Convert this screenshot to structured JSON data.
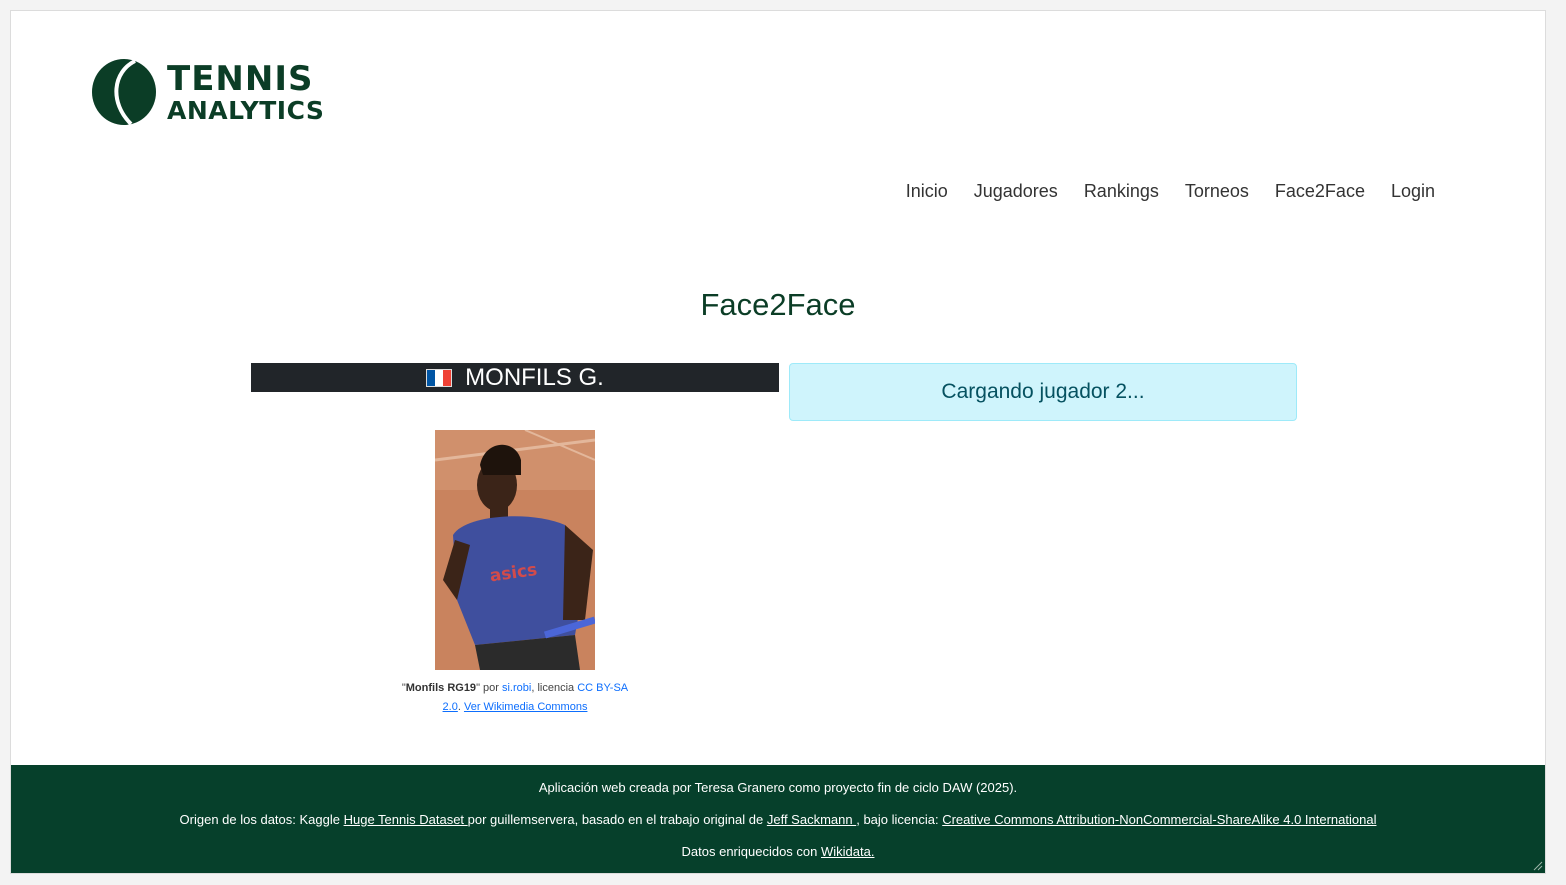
{
  "brand": {
    "line1": "TENNIS",
    "line2": "ANALYTICS",
    "color": "#0b3d26"
  },
  "nav": [
    {
      "label": "Inicio"
    },
    {
      "label": "Jugadores"
    },
    {
      "label": "Rankings"
    },
    {
      "label": "Torneos"
    },
    {
      "label": "Face2Face"
    },
    {
      "label": "Login"
    }
  ],
  "page_title": "Face2Face",
  "player1": {
    "name": "MONFILS G.",
    "flag": "france-flag-icon",
    "photo_caption": {
      "open_quote": "\"",
      "title": "Monfils RG19",
      "close_quote": "\"",
      "by": " por ",
      "author": "si.robi",
      "license_prefix": ", licencia ",
      "license_part1": "CC BY-SA",
      "license_part2": "2.0",
      "sep": ". ",
      "commons_link": "Ver Wikimedia Commons"
    }
  },
  "player2": {
    "loading_text": "Cargando jugador 2..."
  },
  "footer": {
    "line1": "Aplicación web creada por Teresa Granero como proyecto fin de ciclo DAW (2025).",
    "line2_a": "Origen de los datos: Kaggle ",
    "line2_link1": "Huge Tennis Dataset ",
    "line2_b": "por guillemservera, basado en el trabajo original de ",
    "line2_link2": "Jeff Sackmann ",
    "line2_c": ", bajo licencia: ",
    "line2_link3": "Creative Commons Attribution-NonCommercial-ShareAlike 4.0 International",
    "line3_a": "Datos enriquecidos con ",
    "line3_link": "Wikidata."
  },
  "colors": {
    "brand_green": "#06402b",
    "player_bar": "#212529",
    "info_bg": "#cff4fc",
    "info_text": "#055160",
    "link": "#0d6efd"
  }
}
